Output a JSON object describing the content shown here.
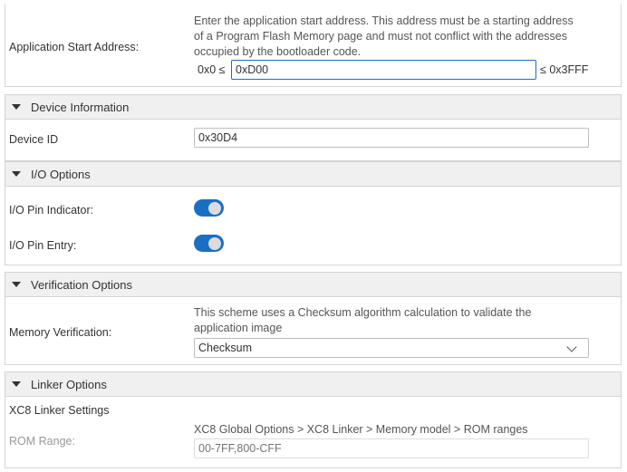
{
  "app_start": {
    "label": "Application Start Address:",
    "description": "Enter the application start address. This address must be a starting address of a Program Flash Memory page and must not conflict with the addresses occupied by the bootloader code.",
    "min_label": "0x0 ≤",
    "value": "0xD00",
    "max_label": "≤ 0x3FFF"
  },
  "device_info": {
    "title": "Device Information",
    "device_id_label": "Device ID",
    "device_id_value": "0x30D4"
  },
  "io_options": {
    "title": "I/O Options",
    "pin_indicator_label": "I/O Pin Indicator:",
    "pin_indicator_on": true,
    "pin_entry_label": "I/O Pin Entry:",
    "pin_entry_on": true
  },
  "verification": {
    "title": "Verification Options",
    "memory_label": "Memory Verification:",
    "description": "This scheme uses a Checksum algorithm calculation to validate the application image",
    "selected": "Checksum"
  },
  "linker": {
    "title": "Linker Options",
    "settings_label": "XC8 Linker Settings",
    "path": "XC8 Global Options > XC8 Linker > Memory model > ROM ranges",
    "rom_label": "ROM Range:",
    "rom_placeholder": "00-7FF,800-CFF"
  },
  "colors": {
    "toggle_on": "#1a6fc4",
    "header_bg": "#f0f0f0",
    "focus_border": "#1a6fc4"
  }
}
